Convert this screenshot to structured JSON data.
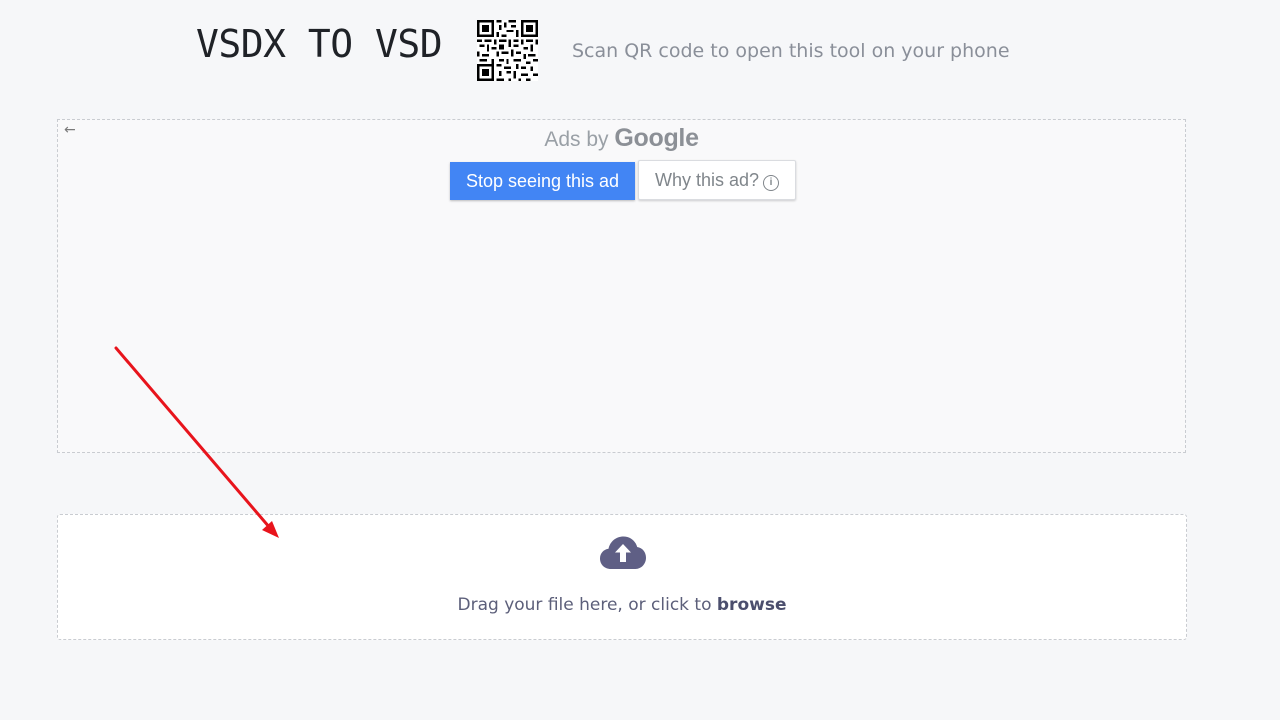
{
  "header": {
    "title": "VSDX TO VSD",
    "qr_hint": "Scan QR code to open this tool on your phone"
  },
  "ad": {
    "back_icon": "←",
    "ads_by": "Ads by",
    "google": "Google",
    "stop_label": "Stop seeing this ad",
    "why_label": "Why this ad?",
    "info_icon": "i"
  },
  "upload": {
    "text": "Drag your file here, or click to",
    "browse": "browse"
  },
  "colors": {
    "accent": "#4285f4",
    "upload_icon": "#5f5f85",
    "annotation": "#e8141c"
  }
}
